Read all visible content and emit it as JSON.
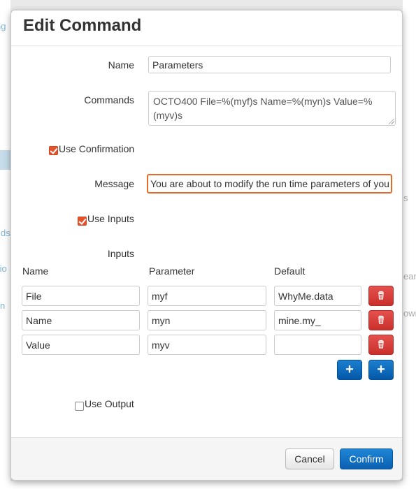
{
  "modal": {
    "title": "Edit Command"
  },
  "form": {
    "name_label": "Name",
    "name_value": "Parameters",
    "commands_label": "Commands",
    "commands_value": "OCTO400 File=%(myf)s Name=%(myn)s Value=%(myv)s",
    "use_confirmation_label": "Use Confirmation",
    "use_confirmation_checked": true,
    "message_label": "Message",
    "message_value": "You are about to modify the run time parameters of you",
    "use_inputs_label": "Use Inputs",
    "use_inputs_checked": true,
    "inputs_label": "Inputs",
    "use_output_label": "Use Output",
    "use_output_checked": false
  },
  "inputs_table": {
    "headers": {
      "name": "Name",
      "parameter": "Parameter",
      "default": "Default"
    },
    "rows": [
      {
        "name": "File",
        "parameter": "myf",
        "default": "WhyMe.data"
      },
      {
        "name": "Name",
        "parameter": "myn",
        "default": "mine.my_"
      },
      {
        "name": "Value",
        "parameter": "myv",
        "default": ""
      }
    ],
    "delete_icon": "trash-icon",
    "add_icon": "plus-icon"
  },
  "footer": {
    "cancel_label": "Cancel",
    "confirm_label": "Confirm"
  },
  "background": {
    "fragments": [
      "ng",
      "ds",
      "tio",
      "n",
      "s",
      "ear",
      "own"
    ]
  },
  "colors": {
    "checkbox_accent": "#e5532d",
    "focus_border": "#e66a2c",
    "primary_button": "#0b5fb0",
    "danger_button": "#c9302c"
  }
}
